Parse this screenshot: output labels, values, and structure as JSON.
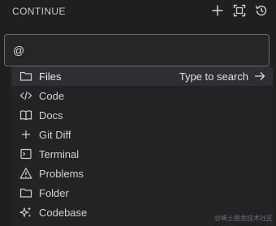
{
  "header": {
    "title": "CONTINUE",
    "icons": [
      "plus-icon",
      "fullscreen-icon",
      "history-icon"
    ]
  },
  "input": {
    "value": "@"
  },
  "dropdown": {
    "items": [
      {
        "label": "Files",
        "icon": "folder-icon",
        "hint": "Type to search",
        "selected": true
      },
      {
        "label": "Code",
        "icon": "code-icon"
      },
      {
        "label": "Docs",
        "icon": "book-icon"
      },
      {
        "label": "Git Diff",
        "icon": "plus-icon"
      },
      {
        "label": "Terminal",
        "icon": "terminal-icon"
      },
      {
        "label": "Problems",
        "icon": "warning-icon"
      },
      {
        "label": "Folder",
        "icon": "folder-icon"
      },
      {
        "label": "Codebase",
        "icon": "sparkles-icon"
      }
    ]
  },
  "watermark": "@稀土掘金技术社区",
  "colors": {
    "background": "#1f1f22",
    "selected_row": "#2f2f33",
    "input_border": "#6a6a70"
  }
}
